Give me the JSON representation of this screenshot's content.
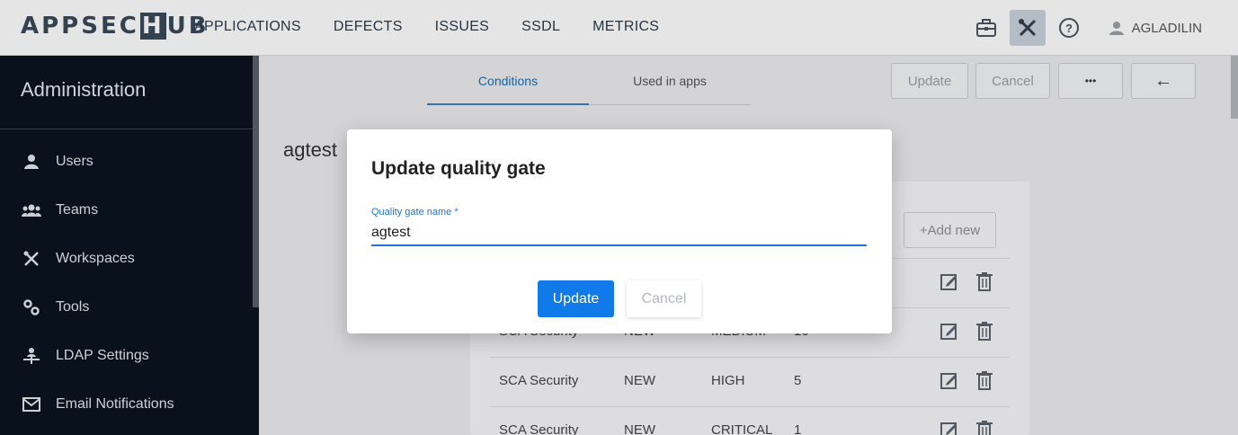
{
  "brand": {
    "prefix": "APPSEC",
    "hub_mark": "H",
    "suffix": "UB"
  },
  "nav": [
    "APPLICATIONS",
    "DEFECTS",
    "ISSUES",
    "SSDL",
    "METRICS"
  ],
  "header": {
    "username": "AGLADILIN"
  },
  "icons": {
    "briefcase": "briefcase-icon",
    "tools": "tools-icon",
    "help": "help-circle-icon",
    "user": "user-avatar-icon"
  },
  "sidebar": {
    "title": "Administration",
    "items": [
      {
        "label": "Users",
        "icon": "user-icon"
      },
      {
        "label": "Teams",
        "icon": "group-icon"
      },
      {
        "label": "Workspaces",
        "icon": "tools-icon"
      },
      {
        "label": "Tools",
        "icon": "gears-icon"
      },
      {
        "label": "LDAP Settings",
        "icon": "ldap-icon"
      },
      {
        "label": "Email Notifications",
        "icon": "mail-icon"
      }
    ]
  },
  "tabs": [
    {
      "label": "Conditions",
      "active": true
    },
    {
      "label": "Used in apps",
      "active": false
    }
  ],
  "toolbar": {
    "update": "Update",
    "cancel": "Cancel",
    "more": "•••",
    "back": "←"
  },
  "page": {
    "title": "agtest"
  },
  "conditions": {
    "add_label": "+Add new",
    "rows": [
      {
        "source": "",
        "status": "",
        "severity": "",
        "count": ""
      },
      {
        "source": "SCA Security",
        "status": "NEW",
        "severity": "MEDIUM",
        "count": "10"
      },
      {
        "source": "SCA Security",
        "status": "NEW",
        "severity": "HIGH",
        "count": "5"
      },
      {
        "source": "SCA Security",
        "status": "NEW",
        "severity": "CRITICAL",
        "count": "1"
      }
    ]
  },
  "modal": {
    "title": "Update quality gate",
    "field_label": "Quality gate name *",
    "field_value": "agtest",
    "update_label": "Update",
    "cancel_label": "Cancel"
  },
  "colors": {
    "accent": "#0f7ae8",
    "sidebar_bg": "#0b1320",
    "link_blue": "#1d74d0"
  }
}
